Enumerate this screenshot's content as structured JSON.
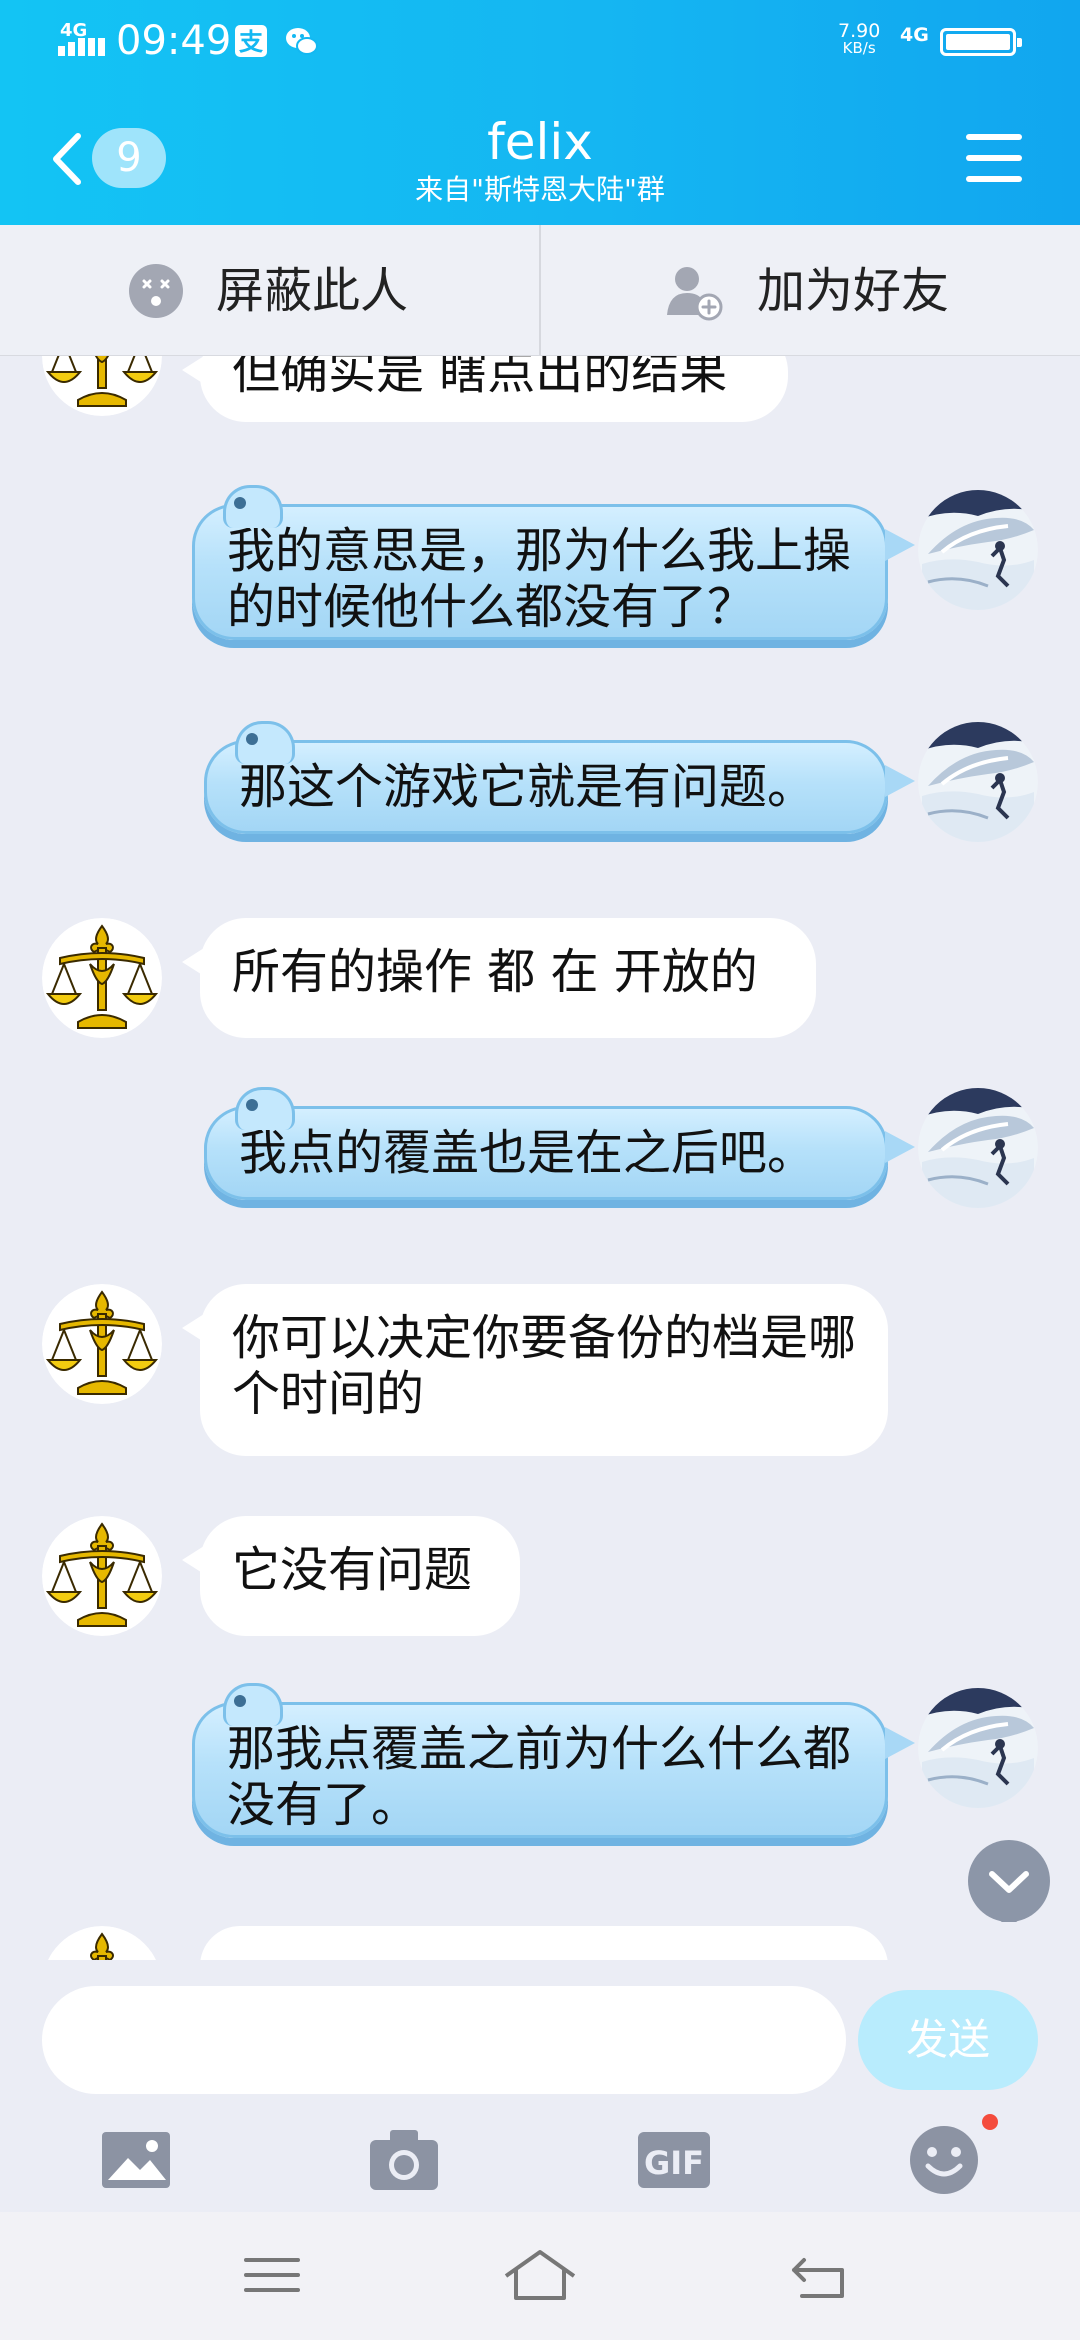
{
  "status_bar": {
    "network_tag": "4G",
    "time": "09:49",
    "speed_value": "7.90",
    "speed_unit": "KB/s",
    "mobile_tag": "4G"
  },
  "header": {
    "unread_count": "9",
    "title": "felix",
    "subtitle": "来自\"斯特恩大陆\"群"
  },
  "actions": {
    "block_label": "屏蔽此人",
    "add_friend_label": "加为好友"
  },
  "messages": [
    {
      "side": "left",
      "text": "但确实是 瞎点出的结果"
    },
    {
      "side": "right",
      "text": "我的意思是，那为什么我上操的时候他什么都没有了？"
    },
    {
      "side": "right",
      "text": "那这个游戏它就是有问题。"
    },
    {
      "side": "left",
      "text": "所有的操作 都 在 开放的"
    },
    {
      "side": "right",
      "text": "我点的覆盖也是在之后吧。"
    },
    {
      "side": "left",
      "text": "你可以决定你要备份的档是哪个时间的"
    },
    {
      "side": "left",
      "text": "它没有问题"
    },
    {
      "side": "right",
      "text": "那我点覆盖之前为什么什么都没有了。"
    }
  ],
  "input": {
    "value": "",
    "placeholder": "",
    "send_label": "发送"
  },
  "toolbar": {
    "gif_label": "GIF"
  },
  "colors": {
    "header_gradient_start": "#13c4f4",
    "header_gradient_end": "#11a6ef",
    "self_bubble": "#b6e1fa",
    "other_bubble": "#ffffff",
    "chat_background": "#ebedf5",
    "notification_dot": "#f44c3d"
  }
}
